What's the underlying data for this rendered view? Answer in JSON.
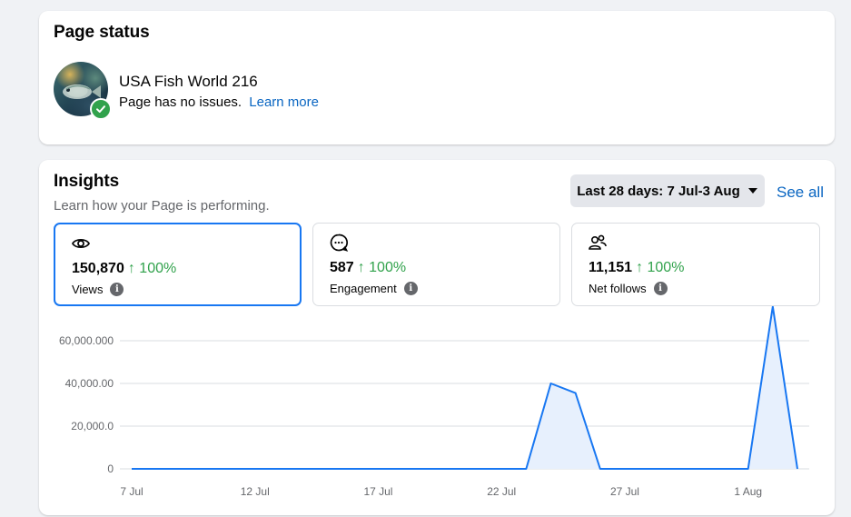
{
  "status": {
    "title": "Page status",
    "page_name": "USA Fish World 216",
    "message": "Page has no issues.",
    "learn_more": "Learn more"
  },
  "insights": {
    "title": "Insights",
    "subtitle": "Learn how your Page is performing.",
    "date_range": "Last 28 days: 7 Jul-3 Aug",
    "see_all": "See all",
    "metrics": [
      {
        "value": "150,870",
        "change": "↑ 100%",
        "label": "Views",
        "icon": "eye-icon"
      },
      {
        "value": "587",
        "change": "↑ 100%",
        "label": "Engagement",
        "icon": "chat-bubble-icon"
      },
      {
        "value": "11,151",
        "change": "↑ 100%",
        "label": "Net follows",
        "icon": "people-icon"
      }
    ]
  },
  "colors": {
    "accent": "#1877f2",
    "link": "#0a66c2",
    "positive": "#31a24c",
    "line": "#1877f2",
    "area": "#e7f0fd"
  },
  "chart_data": {
    "type": "area",
    "y_ticks": [
      "0",
      "20,000.0",
      "40,000.00",
      "60,000.000"
    ],
    "y_tick_values": [
      0,
      20000,
      40000,
      60000
    ],
    "x_ticks": [
      "7 Jul",
      "12 Jul",
      "17 Jul",
      "22 Jul",
      "27 Jul",
      "1 Aug"
    ],
    "x_tick_days": [
      0,
      5,
      10,
      15,
      20,
      25
    ],
    "ylim": [
      0,
      80000
    ],
    "grid": true,
    "series": [
      {
        "x": [
          0,
          1,
          2,
          3,
          4,
          5,
          6,
          7,
          8,
          9,
          10,
          11,
          12,
          13,
          14,
          15,
          16,
          17,
          18,
          19,
          20,
          21,
          22,
          23,
          24,
          25,
          26,
          27
        ],
        "y": [
          0,
          0,
          0,
          0,
          0,
          0,
          0,
          0,
          0,
          0,
          0,
          0,
          0,
          0,
          0,
          0,
          0,
          40000,
          35500,
          0,
          0,
          0,
          0,
          0,
          0,
          0,
          76000,
          0
        ]
      }
    ]
  }
}
